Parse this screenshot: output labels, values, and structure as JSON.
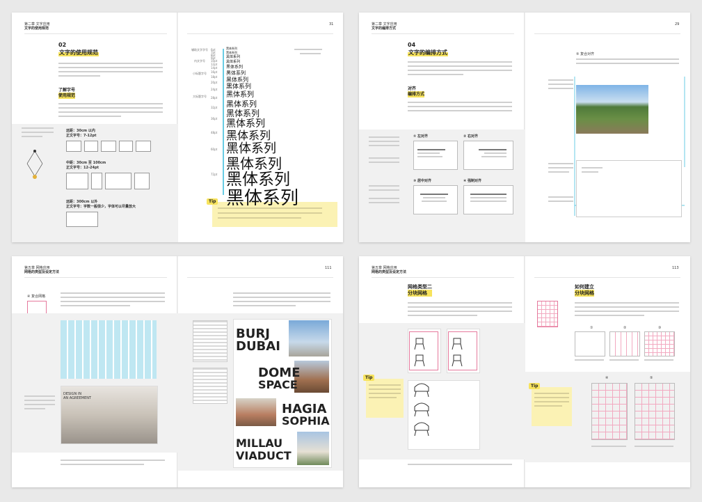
{
  "spreads": [
    {
      "left_header": {
        "chapter": "第二章  文字应用",
        "sub": "文字的使用规范"
      },
      "right_page_number": "31",
      "section_number": "02",
      "section_title": "文字的使用规范",
      "subsection": [
        "了解字号",
        "使用规范"
      ],
      "spec_labels": [
        "远距：30cm 以内",
        "正文字号：7-12pt",
        "中距：30cm 至 100cm",
        "正文字号：12-24pt",
        "远距：300cm 以外",
        "正文字号：字数一般很少，字体可以尽量放大"
      ],
      "ruler_groups": [
        "辅助文字字号",
        "内文字号",
        "小标题字号",
        "大标题字号"
      ],
      "ruler_sizes": [
        "6pt",
        "7pt",
        "8pt",
        "9pt",
        "10pt",
        "12pt",
        "14pt",
        "16pt",
        "18pt",
        "20pt",
        "24pt",
        "28pt",
        "32pt",
        "36pt",
        "48pt",
        "60pt",
        "72pt"
      ],
      "sample_text": "黑体系列",
      "tip_label": "Tip"
    },
    {
      "left_header": {
        "chapter": "第二章  文字应用",
        "sub": "文字的编排方式"
      },
      "right_page_number": "29",
      "section_number": "04",
      "section_title": "文字的编排方式",
      "subsection": [
        "对齐",
        "编排方式"
      ],
      "align_labels": [
        "① 左对齐",
        "② 右对齐",
        "③ 居中对齐",
        "④ 强制对齐"
      ],
      "right_label": "⑤ 复合对齐"
    },
    {
      "left_header": {
        "chapter": "第五章  网格应用",
        "sub": "网格的类型及设定方法"
      },
      "right_page_number": "111",
      "left_label": "④ 复合网格",
      "magazine_heading": [
        "DESIGN IN",
        "AN AGREEMENT"
      ],
      "bigwords": [
        "BURJ",
        "DUBAI",
        "DOME",
        "SPACE",
        "HAGIA",
        "SOPHIA",
        "MILLAU",
        "VIADUCT"
      ]
    },
    {
      "left_header": {
        "chapter": "第五章  网格应用",
        "sub": "网格的类型及设定方法"
      },
      "right_page_number": "113",
      "left_title": [
        "网格类型二",
        "分块网格"
      ],
      "right_title": [
        "如何建立",
        "分块网格"
      ],
      "tip_label": "Tip",
      "step_numbers": [
        "①",
        "②",
        "③",
        "④",
        "⑤"
      ]
    }
  ]
}
